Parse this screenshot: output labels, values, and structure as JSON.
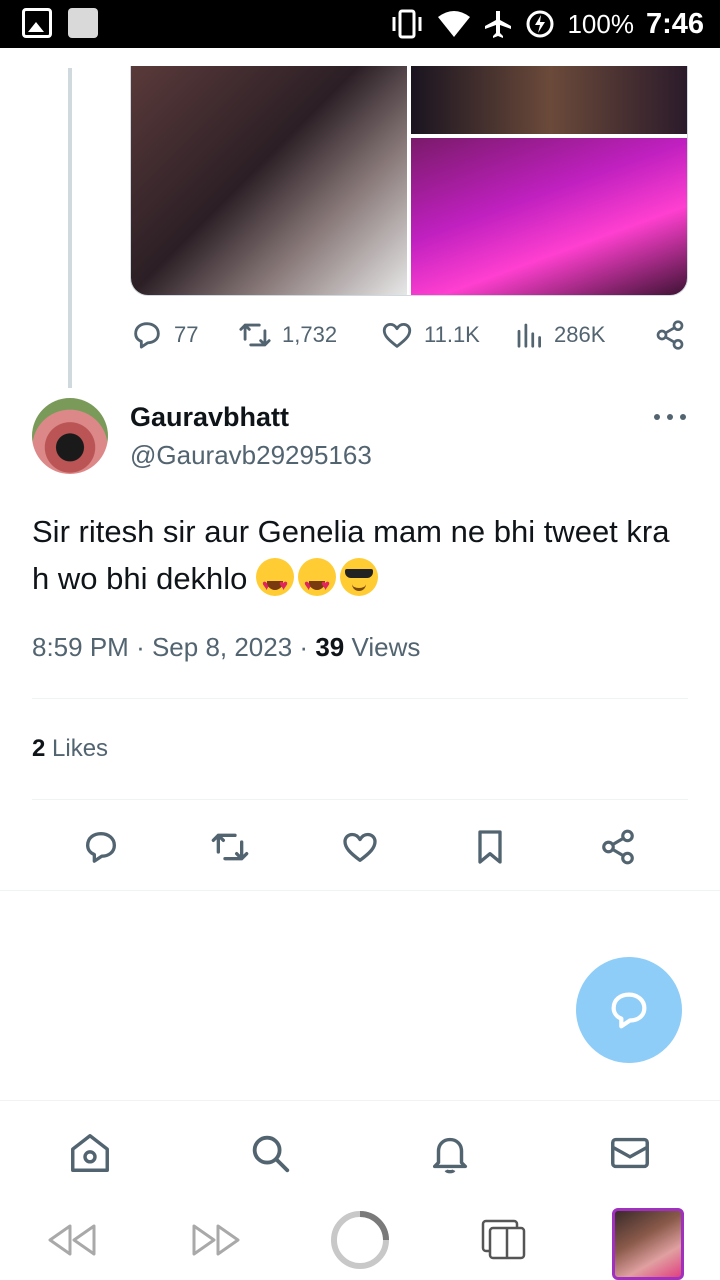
{
  "status_bar": {
    "battery": "100%",
    "time": "7:46",
    "icons": [
      "image-icon",
      "square-notification-icon",
      "vibrate-icon",
      "wifi-icon",
      "airplane-icon",
      "battery-saver-icon"
    ]
  },
  "quoted_tweet": {
    "stats": {
      "replies": "77",
      "retweets": "1,732",
      "likes": "11.1K",
      "views": "286K"
    }
  },
  "tweet": {
    "author_name": "Gauravbhatt",
    "author_handle": "@Gauravb29295163",
    "text": "Sir ritesh sir aur Genelia mam ne bhi tweet kra h wo bhi dekhlo",
    "time": "8:59 PM",
    "date": "Sep 8, 2023",
    "views_count": "39",
    "views_label": "Views",
    "likes_count": "2",
    "likes_label": "Likes"
  },
  "colors": {
    "accent": "#1d9bf0",
    "fab": "#8ecdf8",
    "muted": "#536471",
    "divider": "#eff3f4"
  }
}
